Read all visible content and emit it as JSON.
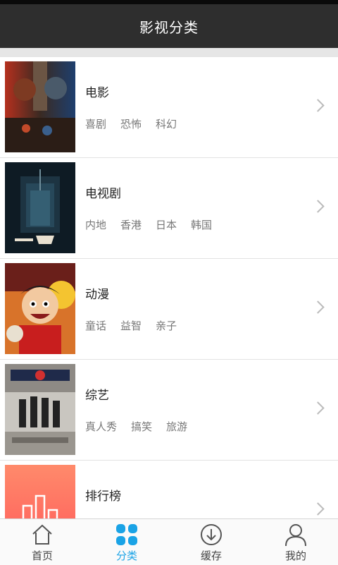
{
  "header": {
    "title": "影视分类"
  },
  "categories": [
    {
      "title": "电影",
      "tags": [
        "喜剧",
        "恐怖",
        "科幻"
      ],
      "poster": "warcraft-movie-poster"
    },
    {
      "title": "电视剧",
      "tags": [
        "内地",
        "香港",
        "日本",
        "韩国"
      ],
      "poster": "tv-drama-poster"
    },
    {
      "title": "动漫",
      "tags": [
        "童话",
        "益智",
        "亲子"
      ],
      "poster": "anime-poster"
    },
    {
      "title": "综艺",
      "tags": [
        "真人秀",
        "搞笑",
        "旅游"
      ],
      "poster": "variety-show-poster"
    },
    {
      "title": "排行榜",
      "tags": [],
      "poster": "ranking-chart-icon"
    }
  ],
  "tabbar": {
    "items": [
      {
        "label": "首页",
        "icon": "home-icon"
      },
      {
        "label": "分类",
        "icon": "category-grid-icon",
        "active": true
      },
      {
        "label": "缓存",
        "icon": "download-icon"
      },
      {
        "label": "我的",
        "icon": "user-icon"
      }
    ]
  },
  "colors": {
    "accent": "#1aa3e6",
    "header_bg": "#2e2e2e",
    "ranking_gradient_top": "#ff8a6b",
    "ranking_gradient_bottom": "#ff5a5a"
  }
}
